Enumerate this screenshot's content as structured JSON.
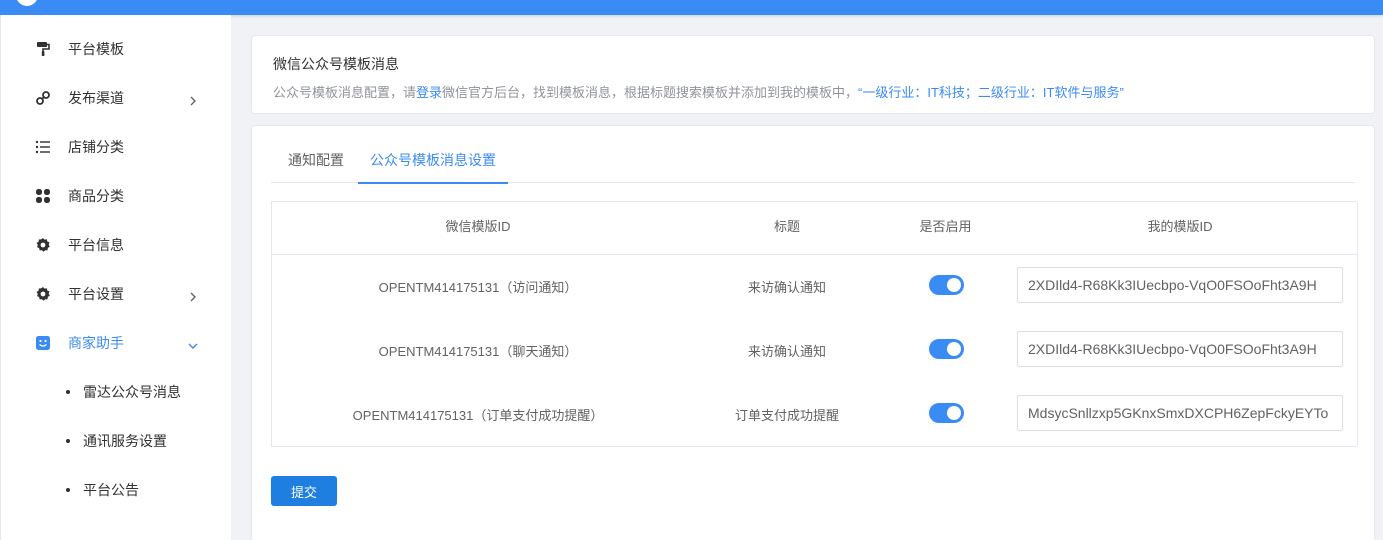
{
  "sidebar": {
    "items": [
      {
        "label": "平台模板",
        "icon": "paint-roller-icon",
        "has_arrow": false
      },
      {
        "label": "发布渠道",
        "icon": "link-icon",
        "has_arrow": true
      },
      {
        "label": "店铺分类",
        "icon": "list-icon",
        "has_arrow": false
      },
      {
        "label": "商品分类",
        "icon": "grid-icon",
        "has_arrow": false
      },
      {
        "label": "平台信息",
        "icon": "gear-icon",
        "has_arrow": false
      },
      {
        "label": "平台设置",
        "icon": "gear-icon",
        "has_arrow": true
      },
      {
        "label": "商家助手",
        "icon": "robot-face-icon",
        "has_arrow": true,
        "expanded": true,
        "active": true
      }
    ],
    "sub_items": [
      {
        "label": "雷达公众号消息"
      },
      {
        "label": "通讯服务设置"
      },
      {
        "label": "平台公告"
      }
    ]
  },
  "info": {
    "title": "微信公众号模板消息",
    "desc_prefix": "公众号模板消息配置，请",
    "desc_link": "登录",
    "desc_middle": "微信官方后台，找到模板消息，根据标题搜索模板并添加到我的模板中，",
    "desc_highlight": "“一级行业：IT科技；二级行业：IT软件与服务”"
  },
  "tabs": [
    {
      "label": "通知配置",
      "active": false
    },
    {
      "label": "公众号模板消息设置",
      "active": true
    }
  ],
  "table": {
    "headers": [
      "微信模版ID",
      "标题",
      "是否启用",
      "我的模版ID"
    ],
    "rows": [
      {
        "template_id": "OPENTM414175131（访问通知）",
        "title": "来访确认通知",
        "enabled": true,
        "my_id": "2XDIld4-R68Kk3IUecbpo-VqO0FSOoFht3A9H"
      },
      {
        "template_id": "OPENTM414175131（聊天通知）",
        "title": "来访确认通知",
        "enabled": true,
        "my_id": "2XDIld4-R68Kk3IUecbpo-VqO0FSOoFht3A9H"
      },
      {
        "template_id": "OPENTM414175131（订单支付成功提醒）",
        "title": "订单支付成功提醒",
        "enabled": true,
        "my_id": "MdsycSnllzxp5GKnxSmxDXCPH6ZepFckyEYTo"
      }
    ]
  },
  "submit_label": "提交",
  "colors": {
    "primary": "#3b8bf5",
    "button": "#1e7fe0",
    "background": "#f0f2f5"
  }
}
